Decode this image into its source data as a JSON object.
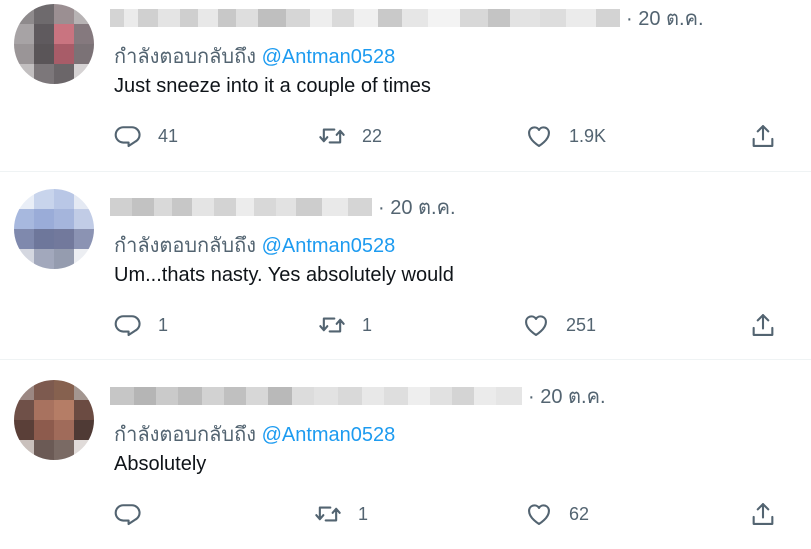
{
  "replies": [
    {
      "time": "· 20 ต.ค.",
      "replying_prefix": "กำลังตอบกลับถึง",
      "mention": "@Antman0528",
      "text": "Just sneeze into it a couple of times",
      "replies_count": "41",
      "retweets_count": "22",
      "likes_count": "1.9K"
    },
    {
      "time": "· 20 ต.ค.",
      "replying_prefix": "กำลังตอบกลับถึง",
      "mention": "@Antman0528",
      "text": "Um...thats nasty. Yes absolutely would",
      "replies_count": "1",
      "retweets_count": "1",
      "likes_count": "251"
    },
    {
      "time": "· 20 ต.ค.",
      "replying_prefix": "กำลังตอบกลับถึง",
      "mention": "@Antman0528",
      "text": "Absolutely",
      "replies_count": "",
      "retweets_count": "1",
      "likes_count": "62"
    }
  ],
  "icons": {
    "reply": "reply-icon",
    "retweet": "retweet-icon",
    "like": "heart-icon",
    "share": "share-icon"
  },
  "colors": {
    "text": "#0f1419",
    "secondary": "#536471",
    "mention": "#1d9bf0",
    "divider": "#eff3f4"
  }
}
